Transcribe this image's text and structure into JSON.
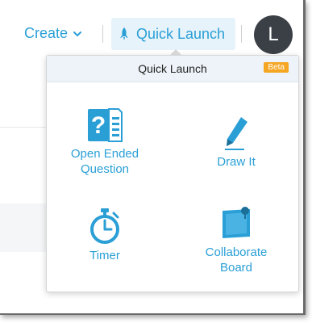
{
  "topbar": {
    "create_label": "Create",
    "quick_launch_label": "Quick Launch",
    "avatar_initial": "L"
  },
  "popup": {
    "title": "Quick Launch",
    "badge": "Beta",
    "items": [
      {
        "line1": "Open Ended",
        "line2": "Question",
        "icon": "question-document-icon"
      },
      {
        "line1": "Draw It",
        "line2": "",
        "icon": "pencil-icon"
      },
      {
        "line1": "Timer",
        "line2": "",
        "icon": "stopwatch-icon"
      },
      {
        "line1": "Collaborate",
        "line2": "Board",
        "icon": "board-pin-icon"
      }
    ]
  },
  "colors": {
    "accent": "#2a9fd6",
    "badge": "#f5a623",
    "avatar": "#3b4047"
  }
}
